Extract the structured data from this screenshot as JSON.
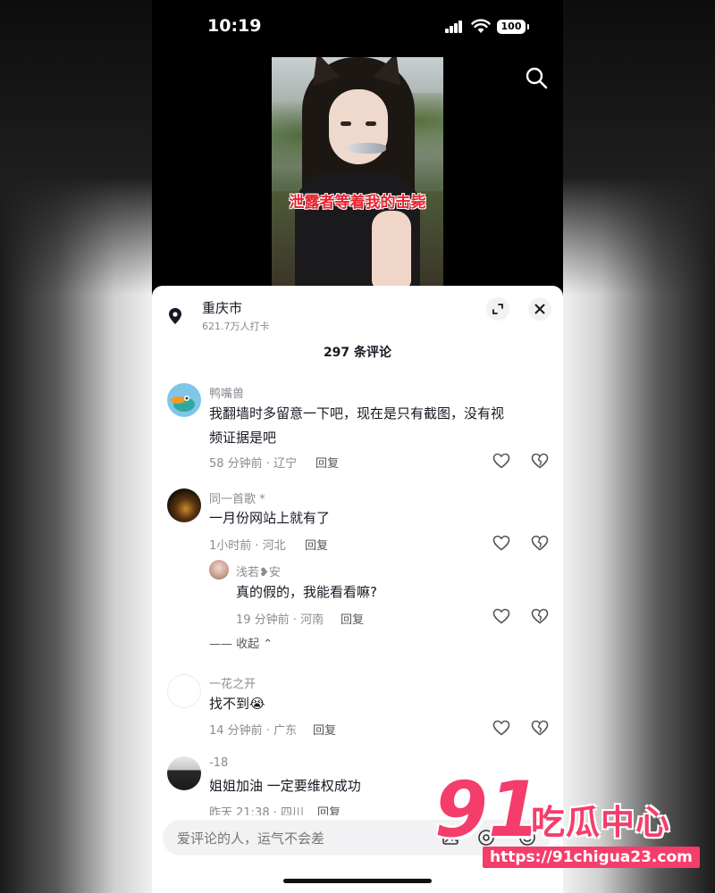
{
  "status_bar": {
    "time": "10:19",
    "battery": "100"
  },
  "video": {
    "caption": "泄露者等着我的击毙"
  },
  "location": {
    "name": "重庆市",
    "checkins": "621.7万人打卡"
  },
  "comments_count": "297 条评论",
  "comments": [
    {
      "user": "鸭嘴兽",
      "text": "我翻墙时多留意一下吧，现在是只有截图，没有视频证据是吧",
      "meta": "58 分钟前 · 辽宁",
      "reply": "回复"
    },
    {
      "user": "同一首歌 *",
      "text": "一月份网站上就有了",
      "meta": "1小时前 · 河北",
      "reply": "回复",
      "sub_reply": {
        "user": "浅若❥安",
        "text": "真的假的，我能看看嘛?",
        "meta": "19 分钟前 · 河南",
        "reply": "回复"
      },
      "collapse": "—— 收起 ⌃"
    },
    {
      "user": "一花之开",
      "text": "找不到😭",
      "meta": "14 分钟前 · 广东",
      "reply": "回复"
    },
    {
      "user": "-18",
      "text": "姐姐加油 一定要维权成功",
      "meta": "昨天 21:38 · 四川",
      "reply": "回复"
    }
  ],
  "input": {
    "placeholder": "爱评论的人，运气不会差"
  },
  "watermark": {
    "number": "91",
    "title": "吃瓜中心",
    "url": "https://91chigua23.com"
  },
  "colors": {
    "watermark": "#f53d6b",
    "text": "#161823",
    "meta": "#8a8b91"
  }
}
